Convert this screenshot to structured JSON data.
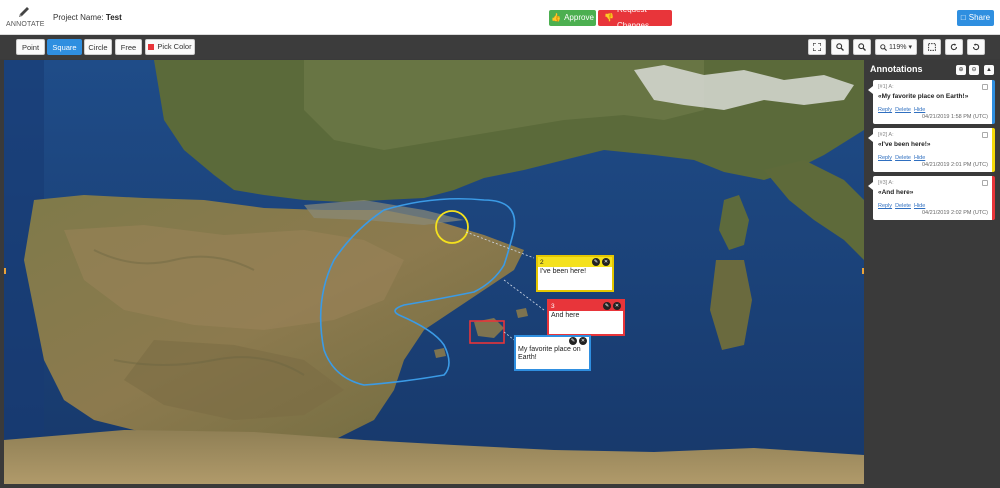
{
  "header": {
    "brand_label": "ANNOTATE",
    "project_label": "Project Name:",
    "project_name": "Test",
    "approve_label": "Approve",
    "request_label": "Request Changes",
    "share_label": "Share",
    "colors": {
      "approve": "#4caf50",
      "request": "#e8353a",
      "share": "#2f8fe0"
    }
  },
  "toolbar": {
    "tools": [
      "Point",
      "Square",
      "Circle",
      "Free",
      "Pick Color"
    ],
    "active_tool": "Square",
    "zoom_label": "119%",
    "icons": [
      "fit-icon",
      "zoom-in-icon",
      "zoom-out-icon",
      "zoom-select-icon",
      "select-region-icon",
      "rotate-icon",
      "undo-icon"
    ]
  },
  "popups": {
    "p2": {
      "num": "2",
      "text": "I've been here!"
    },
    "p3": {
      "num": "3",
      "text": "And here"
    },
    "p1": {
      "text": "My favorite place on Earth!"
    }
  },
  "panel": {
    "title": "Annotations",
    "cards": [
      {
        "num": "[#1] A:",
        "text": "«My favorite place on Earth!»",
        "reply": "Reply",
        "delete": "Delete",
        "hide": "Hide",
        "date": "04/21/2019 1:58 PM (UTC)",
        "color": "#2f8fe0"
      },
      {
        "num": "[#2] A:",
        "text": "«I've been here!»",
        "reply": "Reply",
        "delete": "Delete",
        "hide": "Hide",
        "date": "04/21/2019 2:01 PM (UTC)",
        "color": "#f4d90b"
      },
      {
        "num": "[#3] A:",
        "text": "«And here»",
        "reply": "Reply",
        "delete": "Delete",
        "hide": "Hide",
        "date": "04/21/2019 2:02 PM (UTC)",
        "color": "#e8353a"
      }
    ]
  }
}
